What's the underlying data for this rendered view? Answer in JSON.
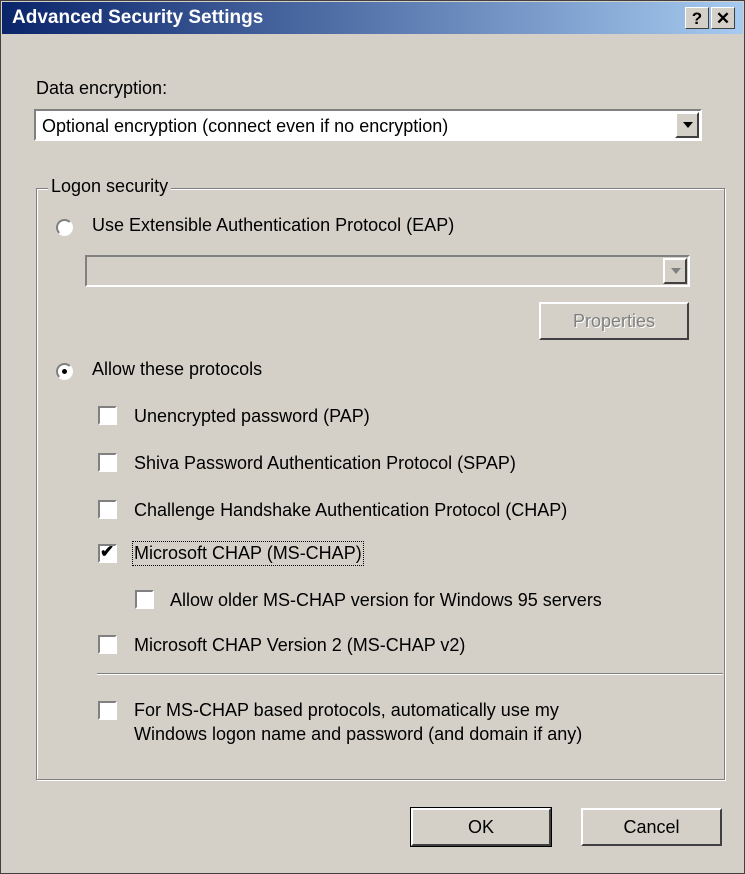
{
  "window": {
    "title": "Advanced Security Settings",
    "help_label": "?",
    "close_label": "✕"
  },
  "encryption": {
    "label": "Data encryption:",
    "selected": "Optional encryption (connect even if no encryption)"
  },
  "logon": {
    "group_label": "Logon security",
    "eap_option": "Use Extensible Authentication Protocol (EAP)",
    "eap_selected": "",
    "properties_label": "Properties",
    "allow_option": "Allow these protocols",
    "protocols": {
      "pap": "Unencrypted password (PAP)",
      "spap": "Shiva Password Authentication Protocol (SPAP)",
      "chap": "Challenge Handshake Authentication Protocol (CHAP)",
      "mschap": "Microsoft CHAP (MS-CHAP)",
      "mschap_older": "Allow older MS-CHAP version for Windows 95 servers",
      "mschapv2": "Microsoft CHAP Version 2 (MS-CHAP v2)"
    },
    "auto_logon_line1": "For MS-CHAP based protocols, automatically use my",
    "auto_logon_line2": "Windows logon name and password (and domain if any)"
  },
  "buttons": {
    "ok": "OK",
    "cancel": "Cancel"
  },
  "state": {
    "eap": false,
    "allow": true,
    "pap": false,
    "spap": false,
    "chap": false,
    "mschap": true,
    "mschap_older": false,
    "mschapv2": false,
    "auto_logon": false
  },
  "colors": {
    "face": "#d4d0c8",
    "title_start": "#0a246a",
    "title_end": "#a6caf0"
  }
}
